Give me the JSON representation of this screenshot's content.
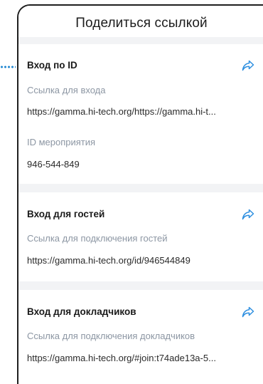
{
  "title": "Поделиться ссылкой",
  "sections": [
    {
      "title": "Вход по ID",
      "fields": [
        {
          "label": "Ссылка для входа",
          "value": "https://gamma.hi-tech.org/https://gamma.hi-t..."
        },
        {
          "label": "ID мероприятия",
          "value": "946-544-849"
        }
      ]
    },
    {
      "title": "Вход для гостей",
      "fields": [
        {
          "label": "Ссылка для подключения гостей",
          "value": "https://gamma.hi-tech.org/id/946544849"
        }
      ]
    },
    {
      "title": "Вход для докладчиков",
      "fields": [
        {
          "label": "Ссылка для подключения докладчиков",
          "value": "https://gamma.hi-tech.org/#join:t74ade13a-5..."
        }
      ]
    }
  ],
  "icons": {
    "share": "share-arrow-icon"
  },
  "colors": {
    "accent": "#2d8fe0",
    "label": "#8c96a3",
    "connector": "#1f86d0"
  }
}
